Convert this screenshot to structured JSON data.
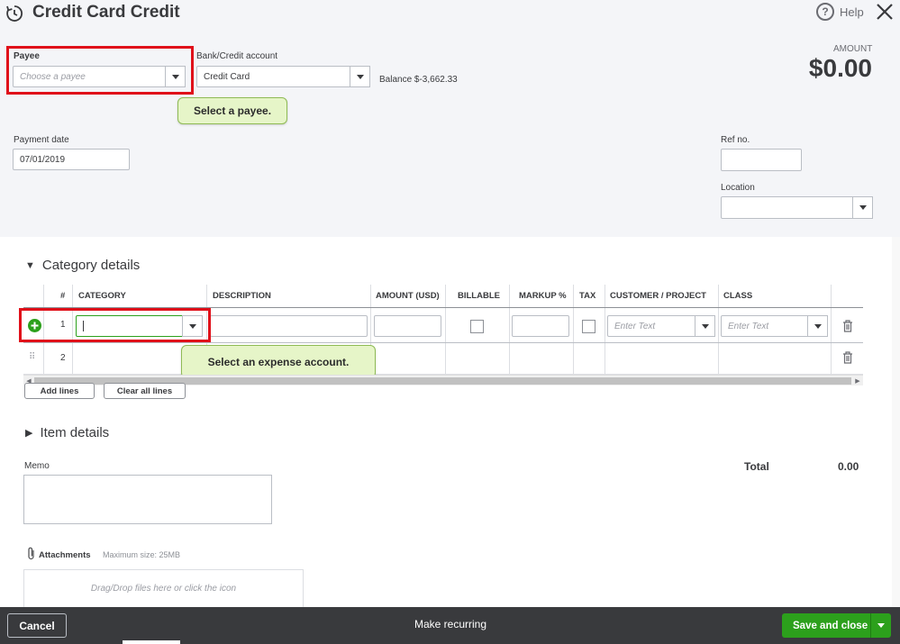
{
  "header": {
    "title": "Credit Card Credit",
    "help_label": "Help",
    "amount_label": "AMOUNT",
    "amount_value": "$0.00"
  },
  "payee": {
    "label": "Payee",
    "placeholder": "Choose a payee",
    "callout": "Select a payee."
  },
  "bank_account": {
    "label": "Bank/Credit account",
    "value": "Credit Card",
    "balance": "Balance $-3,662.33"
  },
  "payment_date": {
    "label": "Payment date",
    "value": "07/01/2019"
  },
  "ref_no": {
    "label": "Ref no.",
    "value": ""
  },
  "location": {
    "label": "Location",
    "value": ""
  },
  "category_details": {
    "title": "Category details",
    "columns": [
      "#",
      "CATEGORY",
      "DESCRIPTION",
      "AMOUNT (USD)",
      "BILLABLE",
      "MARKUP %",
      "TAX",
      "CUSTOMER / PROJECT",
      "CLASS"
    ],
    "rows": [
      {
        "num": "1",
        "customer_placeholder": "Enter Text",
        "class_placeholder": "Enter Text"
      },
      {
        "num": "2"
      }
    ],
    "callout": "Select an expense account.",
    "add_lines": "Add lines",
    "clear_all_lines": "Clear all lines"
  },
  "item_details": {
    "title": "Item details"
  },
  "memo": {
    "label": "Memo"
  },
  "total": {
    "label": "Total",
    "value": "0.00"
  },
  "attachments": {
    "label": "Attachments",
    "max_size": "Maximum size: 25MB",
    "dropzone_text": "Drag/Drop files here or click the icon"
  },
  "footer": {
    "cancel": "Cancel",
    "make_recurring": "Make recurring",
    "save_and_close": "Save and close"
  },
  "colors": {
    "highlight_red": "#e0101a",
    "callout_green": "#e6f5c8",
    "primary_green": "#2ca01c",
    "footer_bg": "#393a3d"
  }
}
